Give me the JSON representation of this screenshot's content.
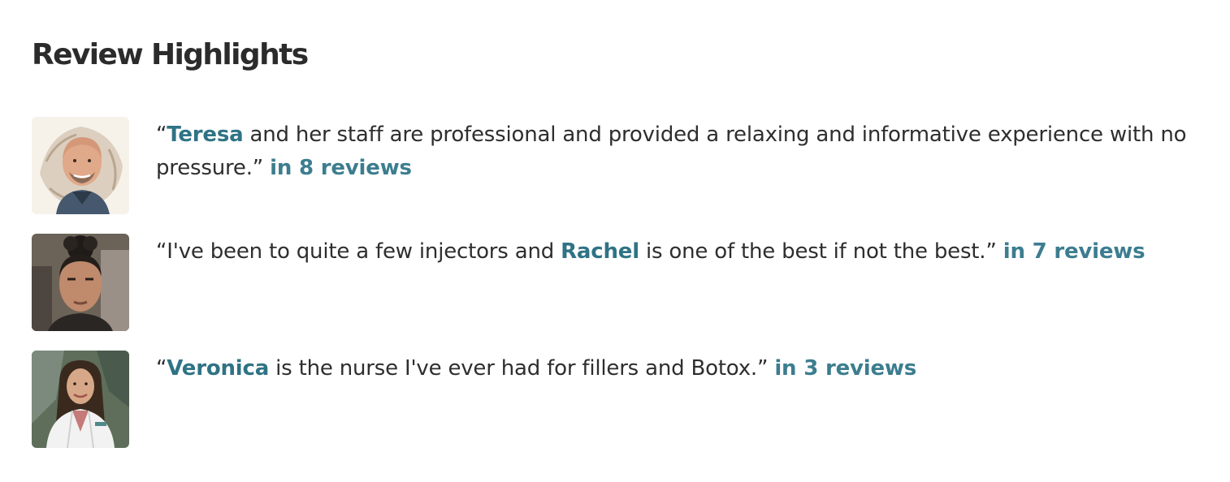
{
  "title": "Review Highlights",
  "colors": {
    "accent": "#2f7385",
    "text": "#2e2e2e",
    "heading": "#2b2b2b"
  },
  "highlights": [
    {
      "avatar_icon": "man-bald-portrait-icon",
      "open_quote": "“",
      "name": "Teresa",
      "before_name": "",
      "after_name": " and her staff are professional and provided a relaxing and informative experience with no pressure.”",
      "reviews_link": "in 8 reviews"
    },
    {
      "avatar_icon": "woman-curly-hair-portrait-icon",
      "open_quote": "“",
      "before_name": "I've been to quite a few injectors and ",
      "name": "Rachel",
      "after_name": " is one of the best if not the best.”",
      "reviews_link": "in 7 reviews"
    },
    {
      "avatar_icon": "woman-lab-coat-portrait-icon",
      "open_quote": "“",
      "before_name": "",
      "name": "Veronica",
      "after_name": " is the nurse I've ever had for fillers and Botox.”",
      "reviews_link": "in 3 reviews"
    }
  ]
}
